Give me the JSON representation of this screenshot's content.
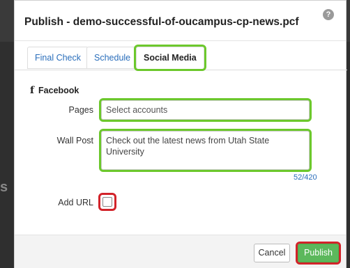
{
  "dialog": {
    "title": "Publish - demo-successful-of-oucampus-cp-news.pcf",
    "help_icon": "?"
  },
  "tabs": [
    {
      "label": "Final Check"
    },
    {
      "label": "Schedule"
    },
    {
      "label": "Social Media",
      "active": true
    }
  ],
  "facebook": {
    "icon": "f",
    "title": "Facebook",
    "pages_label": "Pages",
    "pages_placeholder": "Select accounts",
    "wall_post_label": "Wall Post",
    "wall_post_value": "Check out the latest news from Utah State University",
    "counter": "52/420",
    "add_url_label": "Add URL",
    "add_url_checked": false
  },
  "footer": {
    "cancel_label": "Cancel",
    "publish_label": "Publish"
  },
  "colors": {
    "highlight_green": "#6cc82c",
    "highlight_red": "#d2232a",
    "publish_button": "#5cb85c",
    "link_blue": "#2a6ebb"
  },
  "background": {
    "glyph": "s"
  }
}
